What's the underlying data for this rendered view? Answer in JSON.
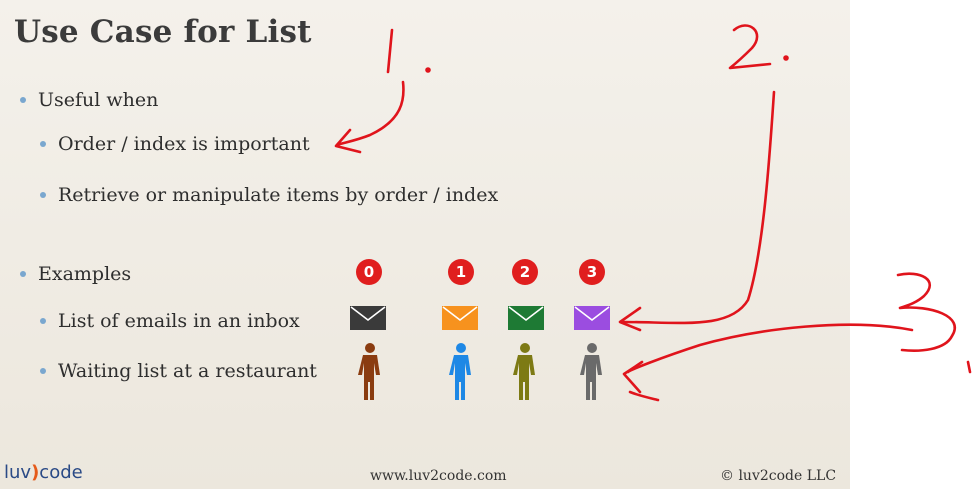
{
  "slide": {
    "title": "Use Case for List",
    "bullets": [
      "Useful when",
      "Order / index is important",
      "Retrieve or manipulate items by order / index",
      "Examples",
      "List of emails in an inbox",
      "Waiting list at a restaurant"
    ],
    "indices": [
      "0",
      "1",
      "2",
      "3"
    ],
    "envelope_colors": [
      "#3a3a3a",
      "#f7921e",
      "#1e7a34",
      "#9b4de0"
    ],
    "person_colors": [
      "#8a3c10",
      "#1e88e5",
      "#7d7a14",
      "#6a6a6a"
    ]
  },
  "annotations": {
    "numbers": [
      "1.",
      "2.",
      "3"
    ],
    "ink_color": "#e0141c"
  },
  "footer": {
    "logo_left": "luv",
    "logo_paren": ")",
    "logo_right": "code",
    "url": "www.luv2code.com",
    "copyright": "© luv2code LLC"
  }
}
